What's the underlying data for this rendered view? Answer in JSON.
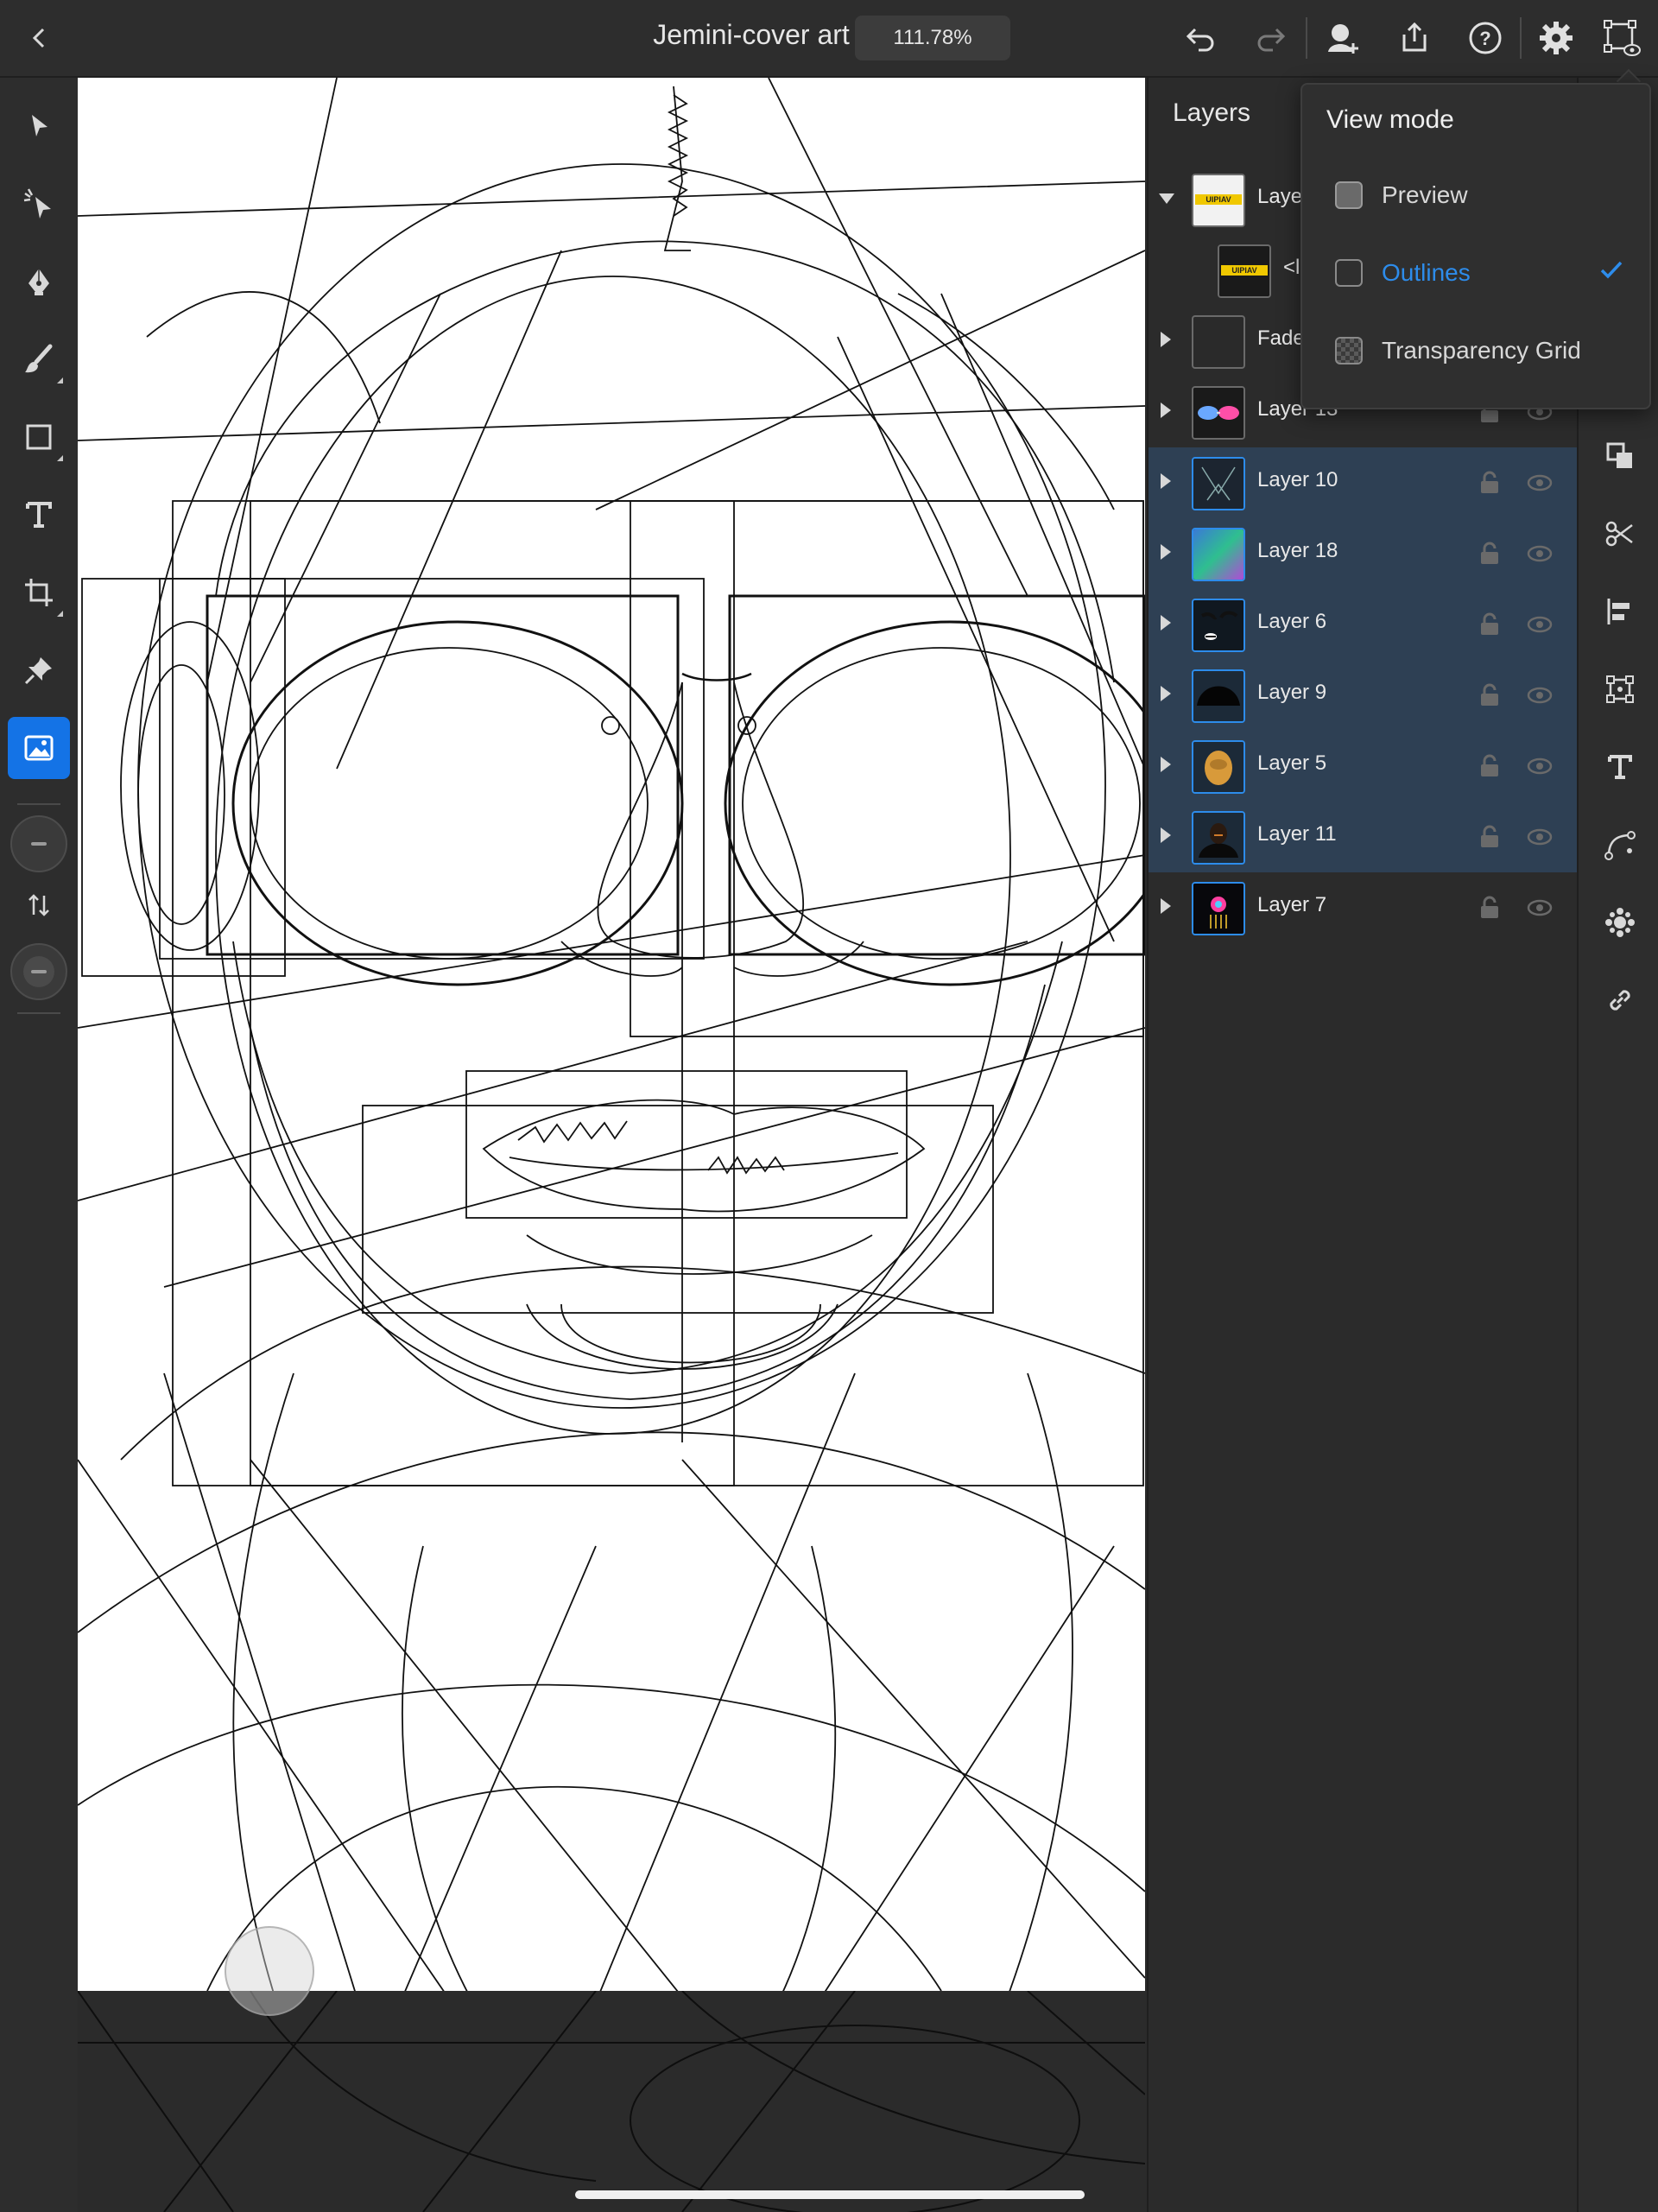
{
  "topbar": {
    "document_title": "Jemini-cover art",
    "zoom_level": "111.78%"
  },
  "layers_panel": {
    "title": "Layers",
    "layers": [
      {
        "name": "Laye",
        "expanded": true,
        "selected": false,
        "child": "<l"
      },
      {
        "name": "Fade",
        "expanded": false,
        "selected": false
      },
      {
        "name": "Layer 13",
        "expanded": false,
        "selected": false
      },
      {
        "name": "Layer 10",
        "expanded": false,
        "selected": true
      },
      {
        "name": "Layer 18",
        "expanded": false,
        "selected": true
      },
      {
        "name": "Layer 6",
        "expanded": false,
        "selected": true
      },
      {
        "name": "Layer 9",
        "expanded": false,
        "selected": true
      },
      {
        "name": "Layer 5",
        "expanded": false,
        "selected": true
      },
      {
        "name": "Layer 11",
        "expanded": false,
        "selected": true
      },
      {
        "name": "Layer 7",
        "expanded": false,
        "selected": false
      }
    ]
  },
  "view_mode": {
    "title": "View mode",
    "options": [
      {
        "label": "Preview",
        "selected": false
      },
      {
        "label": "Outlines",
        "selected": true
      },
      {
        "label": "Transparency Grid",
        "selected": false
      }
    ]
  },
  "colors": {
    "accent": "#1473e6",
    "selection_blue": "#2d8ceb",
    "panel_bg": "#2b2b2b",
    "selected_row_bg": "#2e4054",
    "canvas_bg": "#ffffff"
  },
  "icons": {
    "left_tools": [
      "selection-arrow-icon",
      "direct-selection-icon",
      "pen-icon",
      "brush-icon",
      "rectangle-icon",
      "type-icon",
      "crop-icon",
      "pin-icon",
      "image-icon",
      "swap-icon"
    ],
    "right_tools": [
      "arrange-icon",
      "scissors-icon",
      "align-icon",
      "transform-icon",
      "type-on-path-icon",
      "curve-icon",
      "repeat-icon",
      "link-icon"
    ]
  }
}
